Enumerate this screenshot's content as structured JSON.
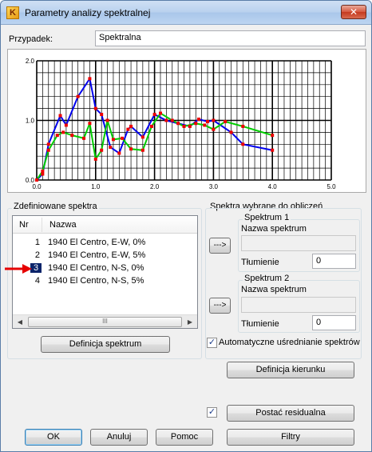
{
  "window": {
    "title": "Parametry analizy spektralnej",
    "app_icon_letter": "K",
    "close_glyph": "✕"
  },
  "case": {
    "label": "Przypadek:",
    "value": "Spektralna"
  },
  "chart_data": {
    "type": "line",
    "xlim": [
      0.0,
      5.0
    ],
    "ylim": [
      0.0,
      2.0
    ],
    "x_ticks": [
      "0.0",
      "1.0",
      "2.0",
      "3.0",
      "4.0",
      "5.0"
    ],
    "y_ticks": [
      "0.0",
      "1.0",
      "2.0"
    ],
    "grid": true,
    "colors": {
      "blue": "#0000ee",
      "green": "#00cc00",
      "red": "#ee0000",
      "grid": "#000000"
    },
    "series": [
      {
        "color": "blue",
        "points": [
          [
            0.0,
            0.0
          ],
          [
            0.1,
            0.1
          ],
          [
            0.2,
            0.6
          ],
          [
            0.4,
            1.08
          ],
          [
            0.5,
            0.92
          ],
          [
            0.7,
            1.4
          ],
          [
            0.9,
            1.7
          ],
          [
            1.0,
            1.2
          ],
          [
            1.1,
            1.1
          ],
          [
            1.25,
            0.55
          ],
          [
            1.4,
            0.45
          ],
          [
            1.55,
            0.85
          ],
          [
            1.6,
            0.9
          ],
          [
            1.8,
            0.72
          ],
          [
            2.0,
            1.1
          ],
          [
            2.2,
            1.0
          ],
          [
            2.4,
            0.95
          ],
          [
            2.6,
            0.9
          ],
          [
            2.75,
            1.02
          ],
          [
            2.9,
            0.98
          ],
          [
            3.0,
            1.0
          ],
          [
            3.3,
            0.8
          ],
          [
            3.5,
            0.6
          ],
          [
            4.0,
            0.5
          ]
        ]
      },
      {
        "color": "green",
        "points": [
          [
            0.0,
            0.0
          ],
          [
            0.1,
            0.15
          ],
          [
            0.2,
            0.5
          ],
          [
            0.35,
            0.75
          ],
          [
            0.45,
            0.8
          ],
          [
            0.6,
            0.75
          ],
          [
            0.8,
            0.7
          ],
          [
            0.9,
            0.95
          ],
          [
            1.0,
            0.35
          ],
          [
            1.1,
            0.5
          ],
          [
            1.2,
            1.0
          ],
          [
            1.3,
            0.68
          ],
          [
            1.45,
            0.7
          ],
          [
            1.6,
            0.52
          ],
          [
            1.8,
            0.5
          ],
          [
            1.95,
            0.9
          ],
          [
            2.1,
            1.12
          ],
          [
            2.3,
            1.0
          ],
          [
            2.5,
            0.9
          ],
          [
            2.7,
            0.95
          ],
          [
            2.85,
            0.92
          ],
          [
            3.0,
            0.85
          ],
          [
            3.2,
            0.98
          ],
          [
            3.5,
            0.9
          ],
          [
            4.0,
            0.75
          ]
        ]
      }
    ],
    "marker_color": "red"
  },
  "defined_spectra": {
    "group_title": "Zdefiniowane spektra",
    "columns": {
      "nr": "Nr",
      "name": "Nazwa"
    },
    "rows": [
      {
        "nr": "1",
        "name": "1940 El Centro, E-W, 0%"
      },
      {
        "nr": "2",
        "name": "1940 El Centro, E-W, 5%"
      },
      {
        "nr": "3",
        "name": "1940 El Centro, N-S, 0%"
      },
      {
        "nr": "4",
        "name": "1940 El Centro, N-S, 5%"
      }
    ],
    "selected_index": 2,
    "scroll_left": "◀",
    "scroll_right": "▶",
    "scroll_grip": "III",
    "define_button": "Definicja spektrum"
  },
  "selected_spectra": {
    "group_title": "Spektra wybrane do obliczeń",
    "transfer_button": "--->",
    "spectrum1": {
      "title": "Spektrum 1",
      "name_label": "Nazwa spektrum",
      "name_value": "",
      "damping_label": "Tłumienie",
      "damping_value": "0"
    },
    "spectrum2": {
      "title": "Spektrum 2",
      "name_label": "Nazwa spektrum",
      "name_value": "",
      "damping_label": "Tłumienie",
      "damping_value": "0"
    },
    "auto_average_label": "Automatyczne uśrednianie spektrów",
    "auto_average_checked": "✓"
  },
  "direction_button": "Definicja kierunku",
  "residual": {
    "checked": "✓",
    "button": "Postać residualna"
  },
  "footer": {
    "ok": "OK",
    "cancel": "Anuluj",
    "help": "Pomoc",
    "filters": "Filtry"
  }
}
